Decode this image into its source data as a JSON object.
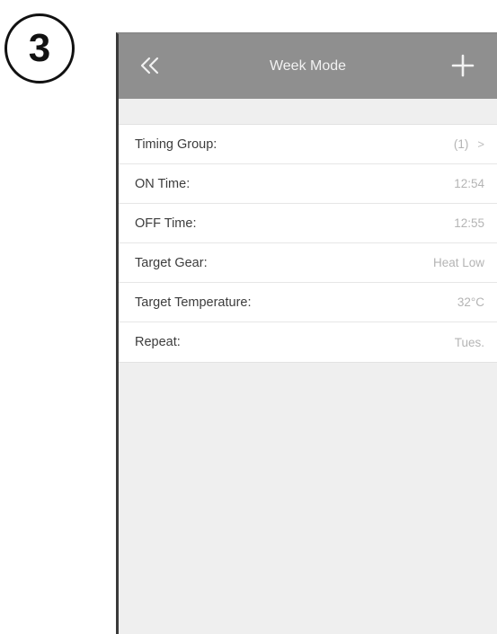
{
  "step": {
    "number": "3"
  },
  "navbar": {
    "back_icon": "double-chevron-left-icon",
    "title": "Week Mode",
    "add_icon": "plus-icon"
  },
  "settings": {
    "rows": [
      {
        "label": "Timing Group:",
        "value": "(1)",
        "chevron": ">"
      },
      {
        "label": "ON Time:",
        "value": "12:54"
      },
      {
        "label": "OFF Time:",
        "value": "12:55"
      },
      {
        "label": "Target Gear:",
        "value": "Heat Low"
      },
      {
        "label": "Target Temperature:",
        "value": "32°C"
      },
      {
        "label": "Repeat:",
        "value": "Tues."
      }
    ]
  },
  "colors": {
    "navbar_bg": "#8f8f8f",
    "screen_bg": "#efefef",
    "list_bg": "#ffffff",
    "label_text": "#3c3c3c",
    "value_text": "#b4b4b4"
  }
}
